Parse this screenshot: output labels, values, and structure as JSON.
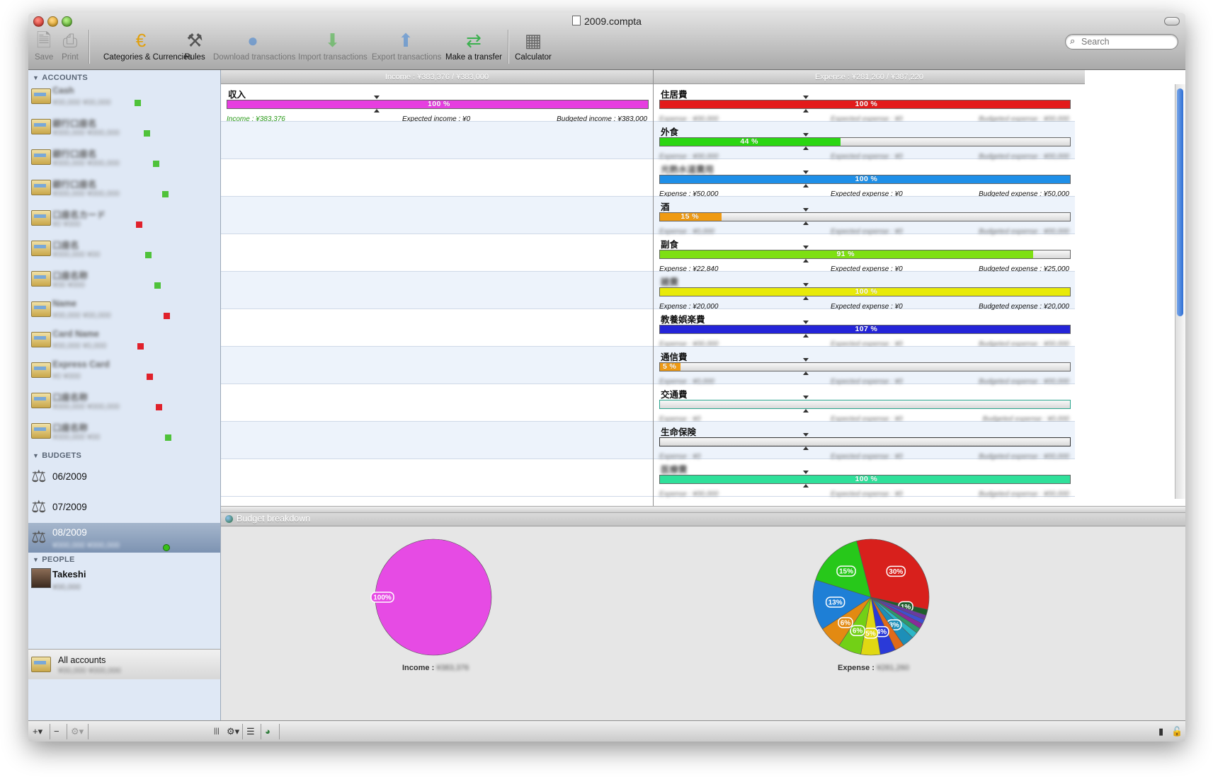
{
  "window": {
    "title": "2009.compta"
  },
  "toolbar": [
    {
      "label": "Save",
      "icon": "save-icon",
      "enabled": false
    },
    {
      "label": "Print",
      "icon": "print-icon",
      "enabled": false
    },
    {
      "label": "Categories & Currencies",
      "icon": "euro-coin-icon",
      "enabled": true
    },
    {
      "label": "Rules",
      "icon": "rules-icon",
      "enabled": true
    },
    {
      "label": "Download transactions",
      "icon": "globe-icon",
      "enabled": false
    },
    {
      "label": "Import transactions",
      "icon": "arrow-down-icon",
      "enabled": false
    },
    {
      "label": "Export transactions",
      "icon": "arrow-up-icon",
      "enabled": false
    },
    {
      "label": "Make a transfer",
      "icon": "transfer-arrows-icon",
      "enabled": true
    },
    {
      "label": "Calculator",
      "icon": "calculator-icon",
      "enabled": true
    }
  ],
  "search": {
    "placeholder": "Search"
  },
  "sidebar": {
    "accounts_header": "ACCOUNTS",
    "accounts": [
      {
        "name": "Cash",
        "balance": "¥00,000 ¥00,000",
        "status": "green"
      },
      {
        "name": "銀行口座名",
        "balance": "¥000,000 ¥000,000",
        "status": "green"
      },
      {
        "name": "銀行口座名",
        "balance": "¥000,000 ¥000,000",
        "status": "green"
      },
      {
        "name": "銀行口座名",
        "balance": "¥000,000 ¥000,000",
        "status": "green"
      },
      {
        "name": "口座名カード",
        "balance": "¥0 ¥000",
        "status": "red"
      },
      {
        "name": "口座名",
        "balance": "¥000,000 ¥00",
        "status": "green"
      },
      {
        "name": "口座名称",
        "balance": "¥00 ¥000",
        "status": "green"
      },
      {
        "name": "Name",
        "balance": "¥00,000 ¥00,000",
        "status": "red"
      },
      {
        "name": "Card Name",
        "balance": "¥00,000 ¥0,000",
        "status": "red"
      },
      {
        "name": "Express Card",
        "balance": "¥0 ¥000",
        "status": "red"
      },
      {
        "name": "口座名称",
        "balance": "¥000,000 ¥000,000",
        "status": "red"
      },
      {
        "name": "口座名称",
        "balance": "¥000,000 ¥00",
        "status": "green"
      }
    ],
    "budgets_header": "BUDGETS",
    "budgets": [
      {
        "label": "06/2009"
      },
      {
        "label": "07/2009"
      },
      {
        "label": "08/2009",
        "subtitle": "¥000,000 ¥000,000"
      }
    ],
    "people_header": "PEOPLE",
    "people": [
      {
        "name": "Takeshi",
        "subtitle": "¥00,000"
      }
    ],
    "all_accounts": {
      "label": "All accounts",
      "subtitle": "¥00,000 ¥000,000"
    }
  },
  "income_panel": {
    "header": "Income : ¥383,376 / ¥383,000",
    "rows": [
      {
        "name": "収入",
        "percent": 100,
        "pct_label": "100 %",
        "color": "#e63ee0",
        "actual": "Income : ¥383,376",
        "expected": "Expected income : ¥0",
        "budgeted": "Budgeted income : ¥383,000"
      }
    ]
  },
  "expense_panel": {
    "header": "Expense : ¥281,260 / ¥387,220",
    "rows": [
      {
        "name": "住居費",
        "percent": 100,
        "pct_label": "100 %",
        "color": "#e31b1b",
        "actual": "Expense : ¥00,000",
        "expected": "Expected expense : ¥0",
        "budgeted": "Budgeted expense : ¥00,000",
        "blurred": true
      },
      {
        "name": "外食",
        "percent": 44,
        "pct_label": "44 %",
        "color": "#2bd612",
        "actual": "Expense : ¥00,000",
        "expected": "Expected expense : ¥0",
        "budgeted": "Budgeted expense : ¥00,000",
        "blurred": true
      },
      {
        "name": "光熱水道費用",
        "percent": 100,
        "pct_label": "100 %",
        "color": "#1e8fe8",
        "actual": "Expense : ¥50,000",
        "expected": "Expected expense : ¥0",
        "budgeted": "Budgeted expense : ¥50,000",
        "blurred": false,
        "name_blurred": true
      },
      {
        "name": "酒",
        "percent": 15,
        "pct_label": "15 %",
        "color": "#ef9a12",
        "actual": "Expense : ¥0,000",
        "expected": "Expected expense : ¥0",
        "budgeted": "Budgeted expense : ¥00,000",
        "blurred": true
      },
      {
        "name": "副食",
        "percent": 91,
        "pct_label": "91 %",
        "color": "#7ee012",
        "actual": "Expense : ¥22,840",
        "expected": "Expected expense : ¥0",
        "budgeted": "Budgeted expense : ¥25,000",
        "blurred": false
      },
      {
        "name": "雑費",
        "percent": 100,
        "pct_label": "100 %",
        "color": "#e8ea08",
        "actual": "Expense : ¥20,000",
        "expected": "Expected expense : ¥0",
        "budgeted": "Budgeted expense : ¥20,000",
        "blurred": false,
        "name_blurred": true
      },
      {
        "name": "教養娯楽費",
        "percent": 107,
        "pct_label": "107 %",
        "color": "#2424d8",
        "actual": "Expense : ¥00,000",
        "expected": "Expected expense : ¥0",
        "budgeted": "Budgeted expense : ¥00,000",
        "blurred": true,
        "over": true
      },
      {
        "name": "通信費",
        "percent": 5,
        "pct_label": "5 %",
        "color": "#ef9a12",
        "actual": "Expense : ¥0,000",
        "expected": "Expected expense : ¥0",
        "budgeted": "Budgeted expense : ¥00,000",
        "blurred": true
      },
      {
        "name": "交通費",
        "percent": 0,
        "pct_label": "",
        "color": "#2aa58d",
        "actual": "Expense : ¥0",
        "expected": "Expected expense : ¥0",
        "budgeted": "Budgeted expense : ¥0,000",
        "blurred": true
      },
      {
        "name": "生命保険",
        "percent": 0,
        "pct_label": "",
        "color": "#333333",
        "actual": "Expense : ¥0",
        "expected": "Expected expense : ¥0",
        "budgeted": "Budgeted expense : ¥00,000",
        "blurred": true
      },
      {
        "name": "医療費",
        "percent": 100,
        "pct_label": "100 %",
        "color": "#2fe09a",
        "actual": "Expense : ¥00,000",
        "expected": "Expected expense : ¥0",
        "budgeted": "Budgeted expense : ¥00,000",
        "blurred": true,
        "name_blurred": true
      }
    ]
  },
  "breakdown": {
    "title": "Budget breakdown",
    "income_label": "Income :",
    "income_value": "¥383,376",
    "expense_label": "Expense :",
    "expense_value": "¥281,260"
  },
  "chart_data": [
    {
      "type": "pie",
      "title": "",
      "slices": [
        {
          "label": "100%",
          "value": 100,
          "color": "#e64be4"
        }
      ]
    },
    {
      "type": "pie",
      "title": "",
      "slices": [
        {
          "label": "30%",
          "value": 30,
          "color": "#d8201c"
        },
        {
          "label": "1%",
          "value": 1.5,
          "color": "#1e5e2c"
        },
        {
          "label": "",
          "value": 1.2,
          "color": "#6a3aa0"
        },
        {
          "label": "",
          "value": 1.2,
          "color": "#3f4fd0"
        },
        {
          "label": "",
          "value": 1.3,
          "color": "#8a2a9a"
        },
        {
          "label": "",
          "value": 1.4,
          "color": "#2f9a6a"
        },
        {
          "label": "",
          "value": 1.6,
          "color": "#2bb7c7"
        },
        {
          "label": "3%",
          "value": 3,
          "color": "#1d8fb8"
        },
        {
          "label": "",
          "value": 2.4,
          "color": "#e06a1a"
        },
        {
          "label": "4%",
          "value": 4,
          "color": "#2a3ad8"
        },
        {
          "label": "5%",
          "value": 5,
          "color": "#e0d812"
        },
        {
          "label": "6%",
          "value": 6,
          "color": "#72d016"
        },
        {
          "label": "6%",
          "value": 6,
          "color": "#e38a12"
        },
        {
          "label": "13%",
          "value": 13,
          "color": "#1e7fd6"
        },
        {
          "label": "15%",
          "value": 15,
          "color": "#27c81a"
        }
      ]
    }
  ]
}
